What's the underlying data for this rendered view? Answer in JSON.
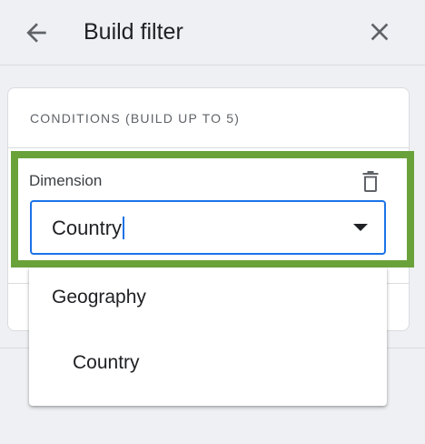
{
  "header": {
    "title": "Build filter",
    "back_icon": "arrow-back-icon",
    "close_icon": "close-icon"
  },
  "conditions": {
    "heading": "CONDITIONS (BUILD UP TO 5)",
    "dimension": {
      "label": "Dimension",
      "value": "Country",
      "delete_icon": "trash-icon"
    }
  },
  "dropdown": {
    "group_label": "Geography",
    "options": [
      {
        "label": "Country"
      }
    ]
  },
  "colors": {
    "highlight": "#6aa23a",
    "focus": "#1a73e8"
  }
}
